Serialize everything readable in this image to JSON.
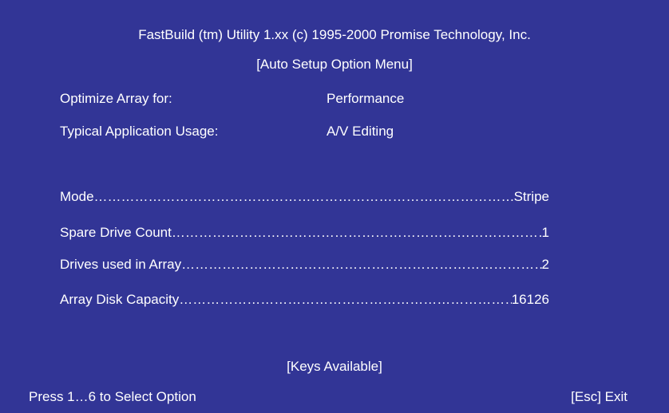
{
  "header": {
    "title": "FastBuild (tm) Utility 1.xx (c) 1995-2000 Promise Technology, Inc.",
    "menu_title": "[Auto Setup Option Menu]"
  },
  "options": [
    {
      "label": "Optimize Array for:",
      "value": "Performance"
    },
    {
      "label": "Typical Application Usage:",
      "value": "A/V Editing"
    }
  ],
  "array_info": [
    {
      "label": "Mode",
      "value": "Stripe"
    },
    {
      "label": "Spare Drive Count",
      "value": "1"
    },
    {
      "label": "Drives used in Array",
      "value": "2"
    },
    {
      "label": "Array Disk Capacity",
      "value": "16126"
    }
  ],
  "keys": {
    "title": "[Keys Available]",
    "select_hint": "Press 1…6 to Select Option",
    "exit_hint": "[Esc] Exit"
  },
  "colors": {
    "background": "#323596",
    "text": "#ffffff"
  }
}
